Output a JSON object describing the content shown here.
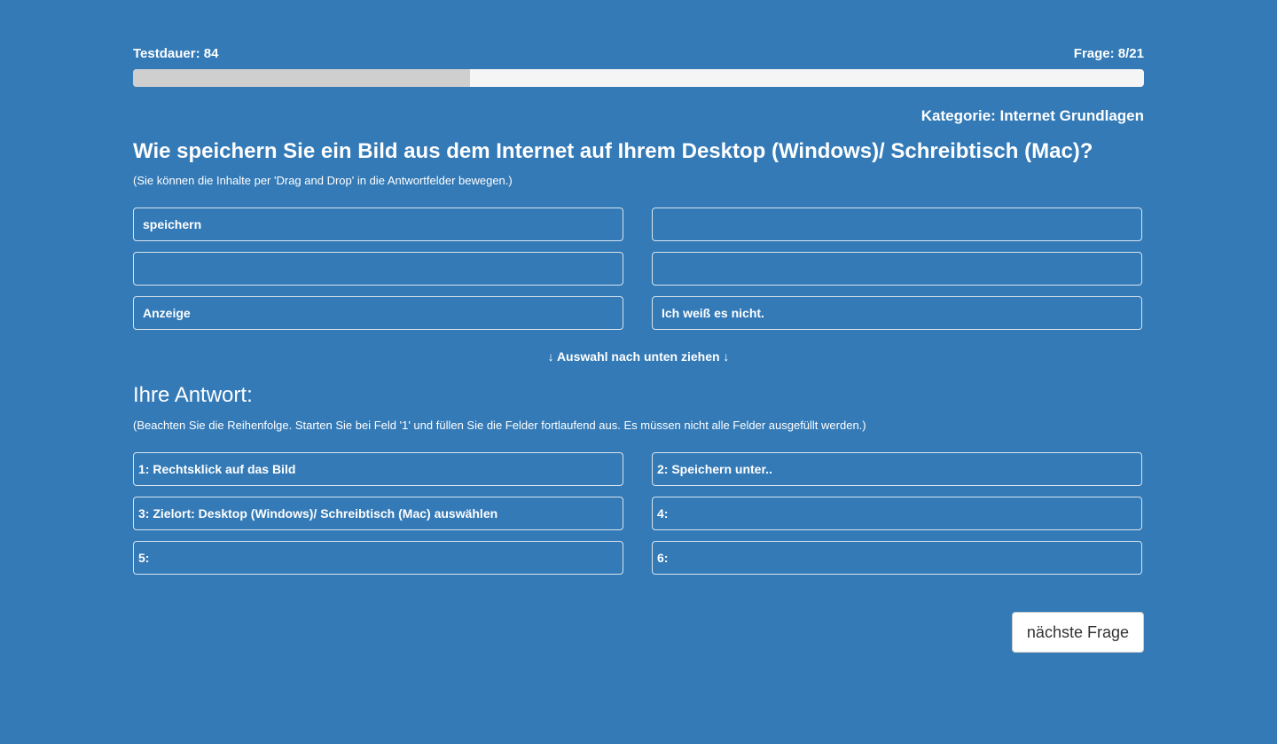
{
  "header": {
    "duration_label": "Testdauer: 84",
    "question_counter": "Frage: 8/21"
  },
  "progress": {
    "fraction": 0.3333
  },
  "category": "Kategorie: Internet Grundlagen",
  "question": {
    "title": "Wie speichern Sie ein Bild aus dem Internet auf Ihrem Desktop (Windows)/ Schreibtisch (Mac)?",
    "instruction": "(Sie können die Inhalte per 'Drag and Drop' in die Antwortfelder bewegen.)"
  },
  "options": [
    "speichern",
    "",
    "",
    "",
    "Anzeige",
    "Ich weiß es nicht."
  ],
  "drag_hint": "↓ Auswahl nach unten ziehen ↓",
  "answer": {
    "heading": "Ihre Antwort:",
    "instruction": "(Beachten Sie die Reihenfolge. Starten Sie bei Feld '1' und füllen Sie die Felder fortlaufend aus. Es müssen nicht alle Felder ausgefüllt werden.)",
    "slots": [
      "1: Rechtsklick auf das Bild",
      "2: Speichern unter..",
      "3: Zielort: Desktop (Windows)/ Schreibtisch (Mac) auswählen",
      "4:",
      "5:",
      "6:"
    ]
  },
  "next_button_label": "nächste Frage",
  "colors": {
    "background": "#337ab7",
    "progress_track": "#f5f5f5",
    "progress_fill": "#cfcfcf"
  }
}
